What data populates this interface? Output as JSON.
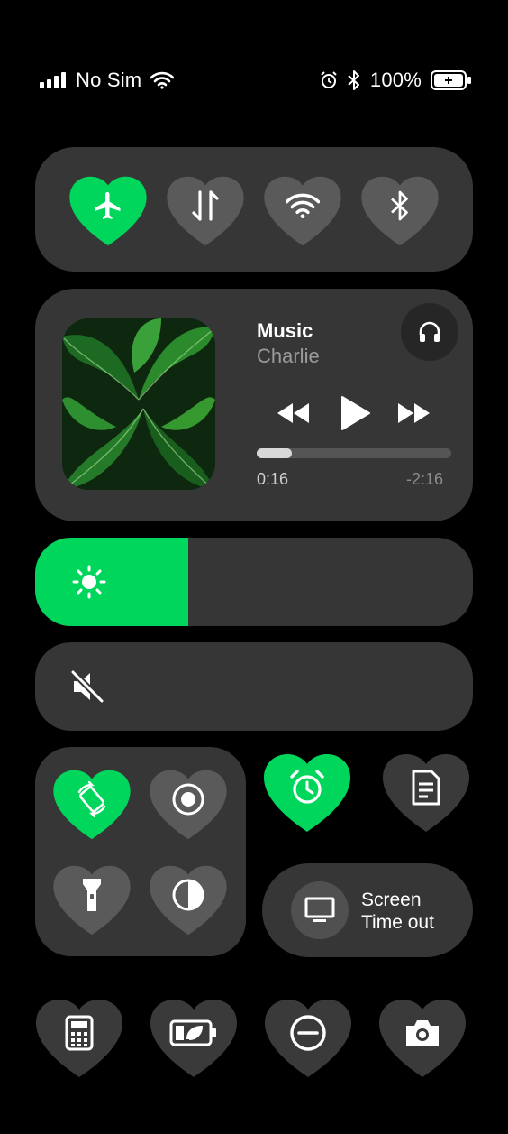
{
  "status_bar": {
    "carrier": "No Sim",
    "battery_percent": "100%",
    "icons": [
      "signal-icon",
      "wifi-icon",
      "alarm-icon",
      "bluetooth-icon",
      "battery-icon"
    ]
  },
  "colors": {
    "accent": "#00d65c",
    "panel": "#363636",
    "tile_inactive": "#5a5a5a",
    "tile_dark": "#3a3a3a",
    "background": "#000000"
  },
  "connectivity": [
    {
      "name": "airplane-mode",
      "icon": "airplane-icon",
      "active": true
    },
    {
      "name": "mobile-data",
      "icon": "data-arrows-icon",
      "active": false
    },
    {
      "name": "wifi",
      "icon": "wifi-icon",
      "active": false
    },
    {
      "name": "bluetooth",
      "icon": "bluetooth-icon",
      "active": false
    }
  ],
  "media": {
    "title": "Music",
    "artist": "Charlie",
    "elapsed": "0:16",
    "remaining": "-2:16",
    "progress_fraction": 0.18,
    "artwork": "leaf-artwork"
  },
  "brightness": {
    "level_fraction": 0.35,
    "icon": "sun-icon"
  },
  "volume": {
    "level_fraction": 0.0,
    "icon": "mute-icon"
  },
  "quick_toggles": [
    {
      "name": "auto-rotate",
      "icon": "rotate-icon",
      "active": true
    },
    {
      "name": "screen-record",
      "icon": "record-icon",
      "active": false
    },
    {
      "name": "flashlight",
      "icon": "flashlight-icon",
      "active": false
    },
    {
      "name": "dark-mode",
      "icon": "contrast-icon",
      "active": false
    }
  ],
  "alarm": {
    "icon": "alarm-icon",
    "active": true
  },
  "notes": {
    "icon": "document-icon",
    "active": false
  },
  "screen_timeout": {
    "line1": "Screen",
    "line2": "Time out",
    "icon": "monitor-icon"
  },
  "bottom_row": [
    {
      "name": "calculator",
      "icon": "calculator-icon"
    },
    {
      "name": "battery-saver",
      "icon": "battery-leaf-icon"
    },
    {
      "name": "do-not-disturb",
      "icon": "minus-circle-icon"
    },
    {
      "name": "camera",
      "icon": "camera-icon"
    }
  ]
}
